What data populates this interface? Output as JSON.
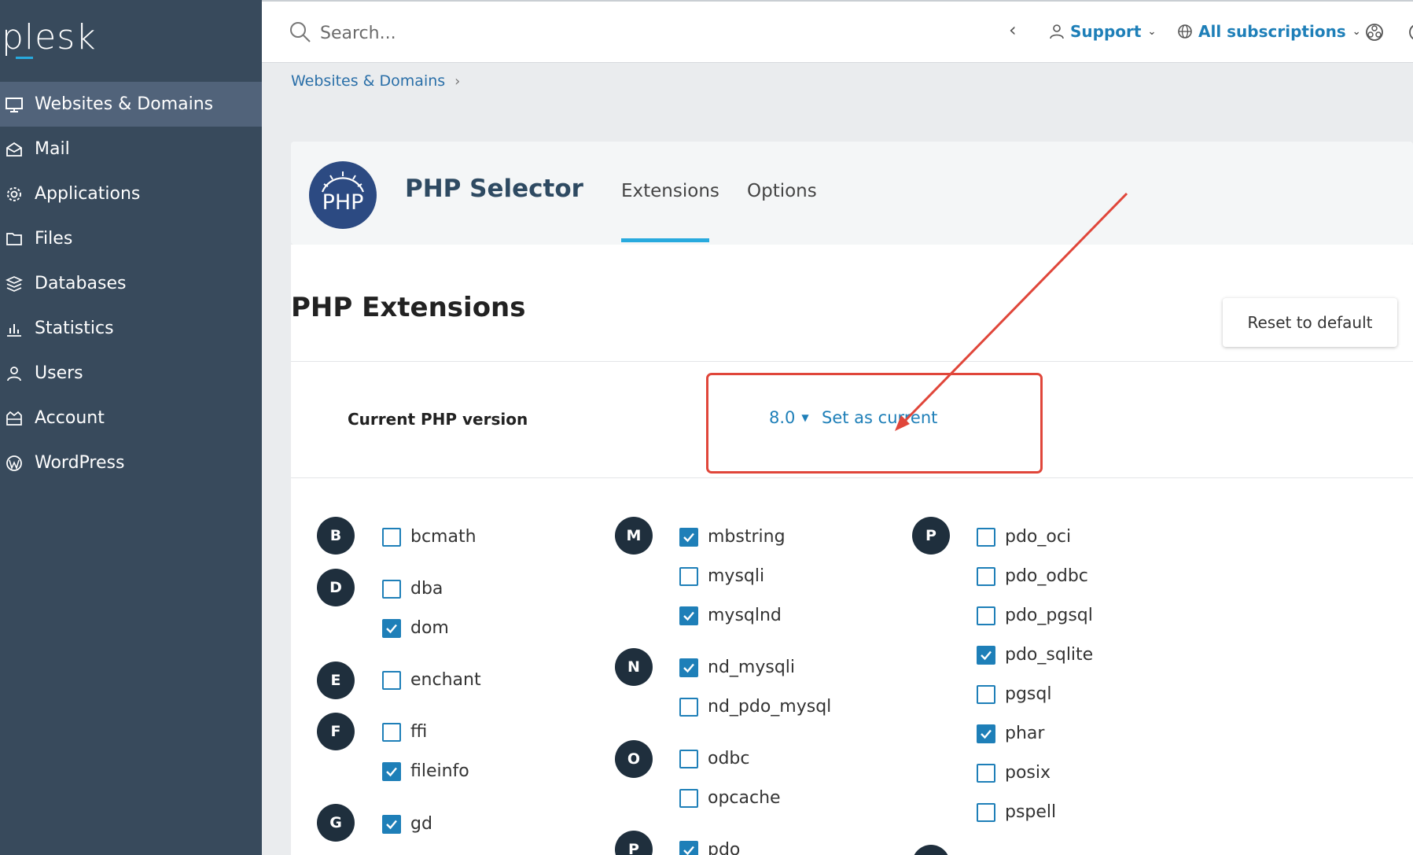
{
  "brand": {
    "logo_text": "plesk"
  },
  "sidebar": {
    "items": [
      {
        "label": "Websites & Domains",
        "icon": "monitor-icon",
        "active": true
      },
      {
        "label": "Mail",
        "icon": "mail-icon"
      },
      {
        "label": "Applications",
        "icon": "gear-icon"
      },
      {
        "label": "Files",
        "icon": "folder-icon"
      },
      {
        "label": "Databases",
        "icon": "database-icon"
      },
      {
        "label": "Statistics",
        "icon": "bar-chart-icon"
      },
      {
        "label": "Users",
        "icon": "user-icon"
      },
      {
        "label": "Account",
        "icon": "account-icon"
      },
      {
        "label": "WordPress",
        "icon": "wordpress-icon"
      }
    ]
  },
  "topbar": {
    "search_placeholder": "Search...",
    "support_label": "Support",
    "subscriptions_label": "All subscriptions"
  },
  "breadcrumb": {
    "item": "Websites & Domains"
  },
  "header": {
    "title": "PHP Selector",
    "logo_text": "PHP",
    "tabs": [
      {
        "label": "Extensions",
        "active": true
      },
      {
        "label": "Options"
      }
    ]
  },
  "main": {
    "section_title": "PHP Extensions",
    "reset_label": "Reset to default",
    "version_label": "Current PHP version",
    "version_value": "8.0",
    "set_current_label": "Set as current"
  },
  "colors": {
    "accent": "#28aade",
    "link": "#1e7fb8",
    "sidebar": "#384a5c",
    "highlight": "#e0463a"
  },
  "extensions": {
    "col1": {
      "letters": [
        "B",
        "D",
        "E",
        "F",
        "G"
      ],
      "items": [
        {
          "name": "bcmath",
          "checked": false
        },
        {
          "name": "dba",
          "checked": false
        },
        {
          "name": "dom",
          "checked": true
        },
        {
          "name": "enchant",
          "checked": false
        },
        {
          "name": "ffi",
          "checked": false
        },
        {
          "name": "fileinfo",
          "checked": true
        },
        {
          "name": "gd",
          "checked": true
        }
      ]
    },
    "col2": {
      "letters": [
        "M",
        "N",
        "O",
        "P"
      ],
      "items": [
        {
          "name": "mbstring",
          "checked": true
        },
        {
          "name": "mysqli",
          "checked": false
        },
        {
          "name": "mysqlnd",
          "checked": true
        },
        {
          "name": "nd_mysqli",
          "checked": true
        },
        {
          "name": "nd_pdo_mysql",
          "checked": false
        },
        {
          "name": "odbc",
          "checked": false
        },
        {
          "name": "opcache",
          "checked": false
        },
        {
          "name": "pdo",
          "checked": true
        }
      ]
    },
    "col3": {
      "letters": [
        "P"
      ],
      "items": [
        {
          "name": "pdo_oci",
          "checked": false
        },
        {
          "name": "pdo_odbc",
          "checked": false
        },
        {
          "name": "pdo_pgsql",
          "checked": false
        },
        {
          "name": "pdo_sqlite",
          "checked": true
        },
        {
          "name": "pgsql",
          "checked": false
        },
        {
          "name": "phar",
          "checked": true
        },
        {
          "name": "posix",
          "checked": false
        },
        {
          "name": "pspell",
          "checked": false
        }
      ]
    }
  }
}
